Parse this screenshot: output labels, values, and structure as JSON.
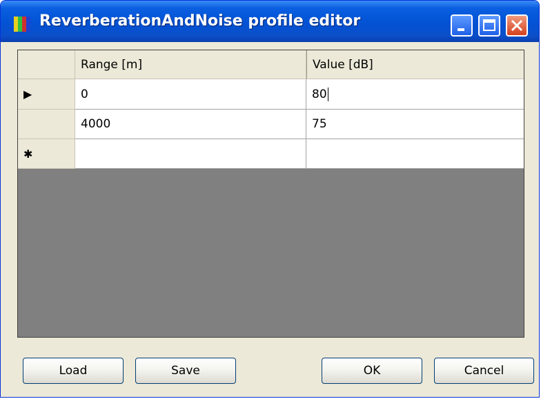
{
  "window": {
    "title": "ReverberationAndNoise profile editor"
  },
  "grid": {
    "columns": [
      "Range [m]",
      "Value [dB]"
    ],
    "rows": [
      {
        "selector": "▶",
        "range": "0",
        "value": "80"
      },
      {
        "selector": "",
        "range": "4000",
        "value": "75"
      },
      {
        "selector": "✱",
        "range": "",
        "value": ""
      }
    ]
  },
  "buttons": {
    "load": "Load",
    "save": "Save",
    "ok": "OK",
    "cancel": "Cancel"
  },
  "colors": {
    "titlebar": "#0a5fe0",
    "close_button": "#d3401e",
    "grid_background": "#808080",
    "dialog_background": "#ece9d8"
  }
}
